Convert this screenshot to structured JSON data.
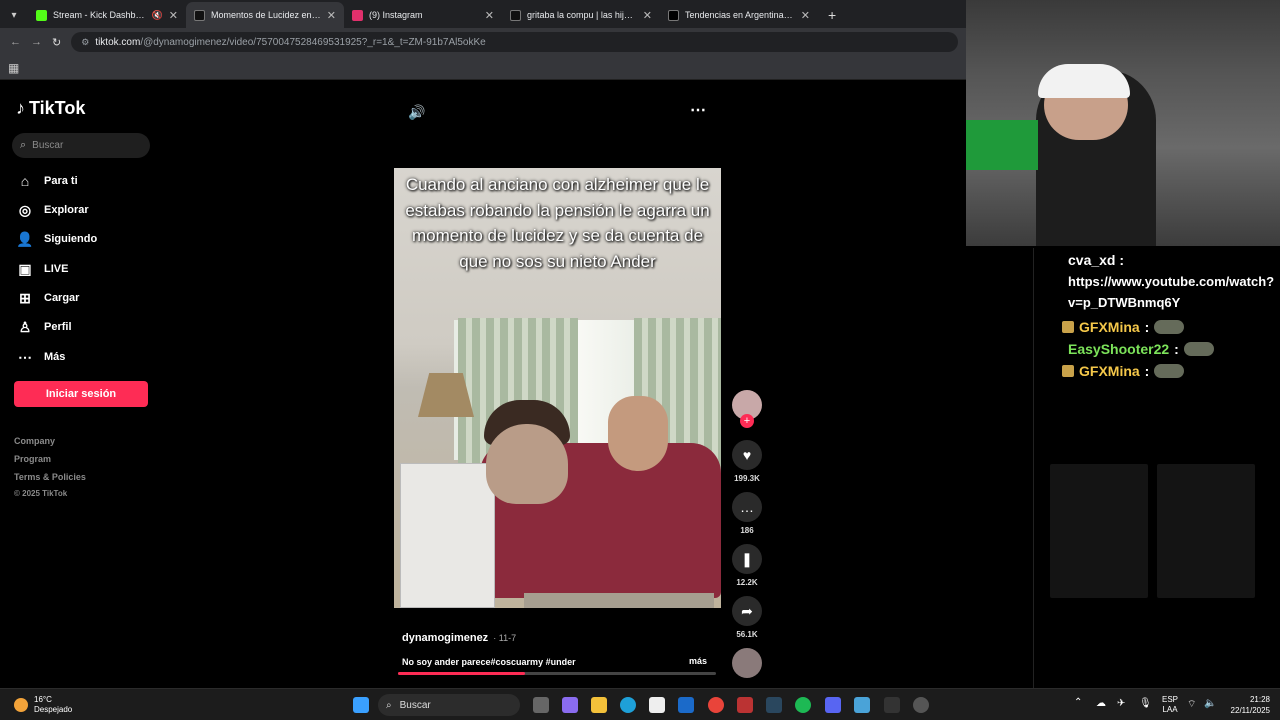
{
  "browser": {
    "tabs": [
      {
        "label": "Stream - Kick Dashboard",
        "icon": "kick-icon",
        "color": "#53fc18"
      },
      {
        "label": "Momentos de Lucidez en la Co",
        "icon": "tiktok-icon",
        "color": "#ffffff"
      },
      {
        "label": "(9) Instagram",
        "icon": "instagram-icon",
        "color": "#e1306c"
      },
      {
        "label": "gritaba la compu | las hijas de l",
        "icon": "tiktok-icon",
        "color": "#ffffff"
      },
      {
        "label": "Tendencias en Argentina on X",
        "icon": "x-icon",
        "color": "#ffffff"
      }
    ],
    "new_tab": "+",
    "url_domain": "tiktok.com",
    "url_path": "/@dynamogimenez/video/7570047528469531925?_r=1&_t=ZM-91b7Al5okKe"
  },
  "tiktok": {
    "brand": "TikTok",
    "search_placeholder": "Buscar",
    "nav": [
      {
        "label": "Para ti",
        "icon": "home-icon"
      },
      {
        "label": "Explorar",
        "icon": "compass-icon"
      },
      {
        "label": "Siguiendo",
        "icon": "following-icon"
      },
      {
        "label": "LIVE",
        "icon": "live-icon"
      },
      {
        "label": "Cargar",
        "icon": "upload-icon"
      },
      {
        "label": "Perfil",
        "icon": "profile-icon"
      },
      {
        "label": "Más",
        "icon": "more-icon"
      }
    ],
    "login_label": "Iniciar sesión",
    "footer": [
      "Company",
      "Program",
      "Terms & Policies",
      "© 2025 TikTok"
    ],
    "accent": "#fe2c55",
    "video": {
      "caption": "Cuando al anciano con alzheimer que le estabas robando la pensión le agarra un momento de lucidez y se da cuenta de que no sos su nieto Ander",
      "author": "dynamogimenez",
      "date": "· 11-7",
      "description": "No soy ander parece#coscuarmy #under",
      "more_label": "más",
      "progress": 0.4
    },
    "actions": {
      "likes": "199.3K",
      "comments": "186",
      "saves": "12.2K",
      "shares": "56.1K"
    }
  },
  "chat": {
    "messages": [
      {
        "user": "cva_xd",
        "user_color": "#ffffff",
        "text": "https://www.youtube.com/watch?v=p_DTWBnmq6Y",
        "badge": false,
        "emote": false
      },
      {
        "user": "GFXMina",
        "user_color": "#f5c84a",
        "text": "",
        "badge": true,
        "emote": true
      },
      {
        "user": "EasyShooter22",
        "user_color": "#7ce35a",
        "text": "",
        "badge": false,
        "emote": true
      },
      {
        "user": "GFXMina",
        "user_color": "#f5c84a",
        "text": "",
        "badge": true,
        "emote": true
      }
    ]
  },
  "taskbar": {
    "weather_temp": "16°C",
    "weather_desc": "Despejado",
    "search_placeholder": "Buscar",
    "lang1": "ESP",
    "lang2": "LAA",
    "time": "21:28",
    "date": "22/11/2025"
  }
}
